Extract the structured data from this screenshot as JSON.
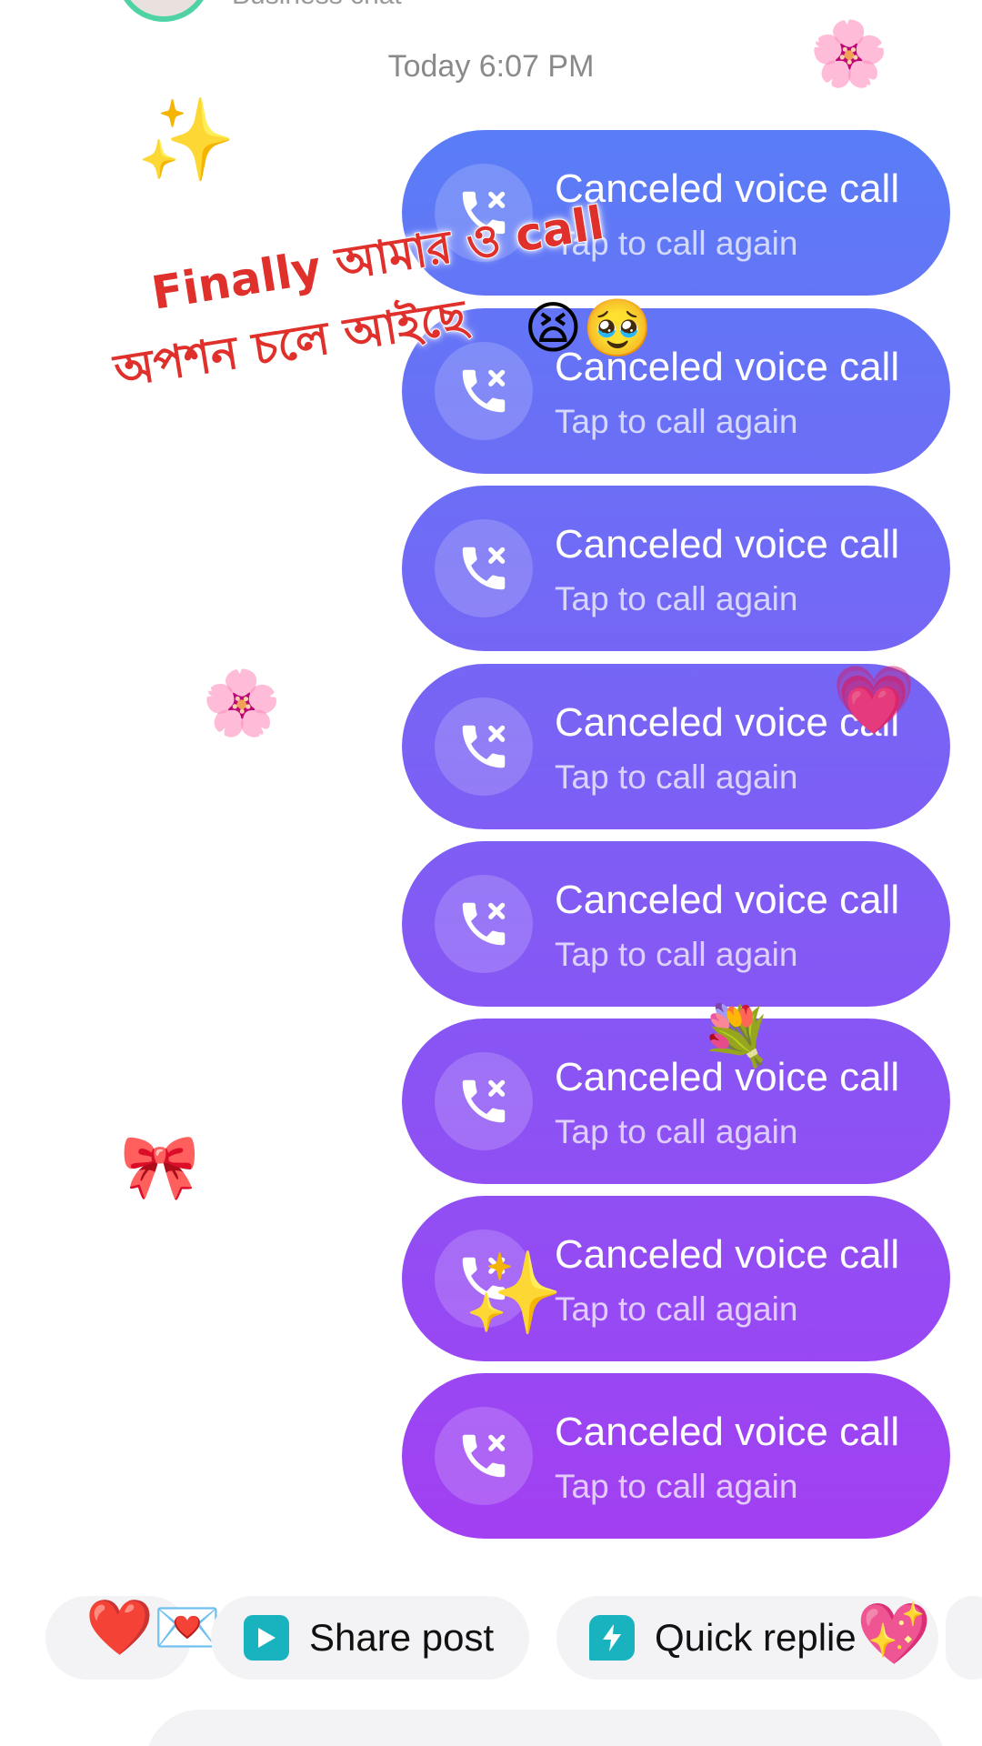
{
  "header": {
    "subtitle": "Business chat"
  },
  "timestamp": "Today 6:07 PM",
  "calls": [
    {
      "title": "Canceled voice call",
      "subtitle": "Tap to call again"
    },
    {
      "title": "Canceled voice call",
      "subtitle": "Tap to call again"
    },
    {
      "title": "Canceled voice call",
      "subtitle": "Tap to call again"
    },
    {
      "title": "Canceled voice call",
      "subtitle": "Tap to call again"
    },
    {
      "title": "Canceled voice call",
      "subtitle": "Tap to call again"
    },
    {
      "title": "Canceled voice call",
      "subtitle": "Tap to call again"
    },
    {
      "title": "Canceled voice call",
      "subtitle": "Tap to call again"
    },
    {
      "title": "Canceled voice call",
      "subtitle": "Tap to call again"
    }
  ],
  "overlay": {
    "line1": "Finally আমার ও call",
    "line2": "অপশন চলে আইছে",
    "emoji": "😫🥹"
  },
  "stickers": {
    "flower": "🌸",
    "sparkles": "✨",
    "heart": "💗",
    "bouquet": "💐",
    "ribbon": "🎀",
    "heart_with_letter": "❤️💌",
    "sparkling_heart": "💖"
  },
  "quick_replies": [
    {
      "label": "Share post",
      "icon": "play-icon"
    },
    {
      "label": "Quick replie",
      "icon": "lightning-icon"
    }
  ],
  "colors": {
    "bubble_gradient_top": "#5a7df7",
    "bubble_gradient_bottom": "#a23ff2",
    "overlay_text": "#e0302c",
    "chip_icon": "#19b3bf",
    "timestamp_text": "#8a8a8a"
  }
}
